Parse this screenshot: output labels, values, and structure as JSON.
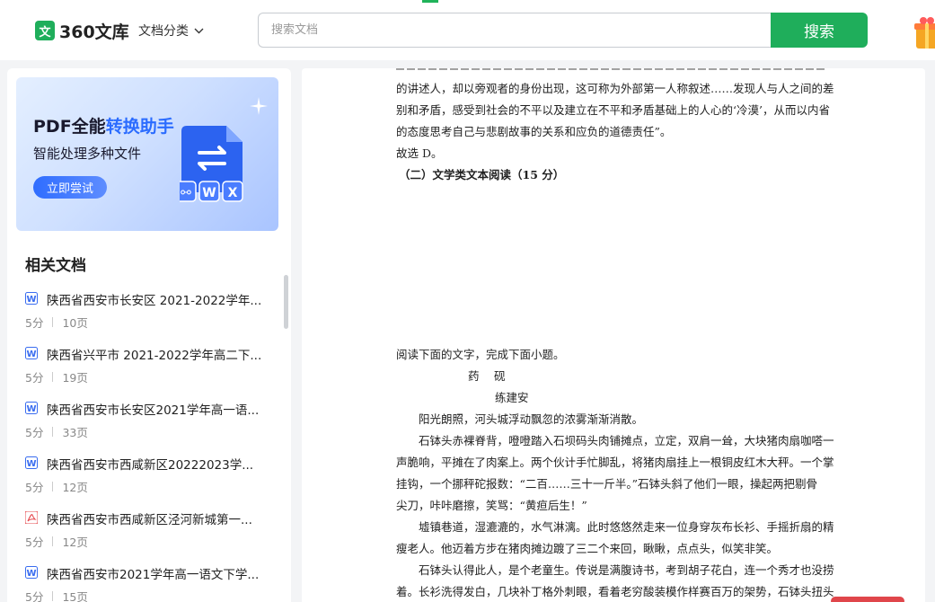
{
  "header": {
    "logo_mark": "文",
    "logo_text": "360文库",
    "category_label": "文档分类",
    "search_placeholder": "搜索文档",
    "search_button": "搜索"
  },
  "banner": {
    "title_prefix": "PDF全能",
    "title_highlight": "转换助手",
    "subtitle": "智能处理多种文件",
    "cta": "立即尝试"
  },
  "related": {
    "title": "相关文档",
    "items": [
      {
        "type": "word",
        "name": "陕西省西安市长安区 2021-2022学年...",
        "score": "5分",
        "pages": "10页"
      },
      {
        "type": "word",
        "name": "陕西省兴平市 2021-2022学年高二下...",
        "score": "5分",
        "pages": "19页"
      },
      {
        "type": "word",
        "name": "陕西省西安市长安区2021学年高一语...",
        "score": "5分",
        "pages": "33页"
      },
      {
        "type": "word",
        "name": "陕西省西安市西咸新区20222023学...",
        "score": "5分",
        "pages": "12页"
      },
      {
        "type": "pdf",
        "name": "陕西省西安市西咸新区泾河新城第一...",
        "score": "5分",
        "pages": "12页"
      },
      {
        "type": "word",
        "name": "陕西省西安市2021学年高一语文下学...",
        "score": "5分",
        "pages": "15页"
      }
    ]
  },
  "document": {
    "lines": [
      "的讲述人，却以旁观者的身份出现，这可称为外部第一人称叙述……发现人与人之间的差",
      "别和矛盾，感受到社会的不平以及建立在不平和矛盾基础上的人心的‘冷漠’，从而以内省",
      "的态度思考自己与悲剧故事的关系和应负的道德责任”。",
      "故选 D。",
      "（二）文学类文本阅读（15 分）",
      "阅读下面的文字，完成下面小题。",
      "药　 砚",
      "练建安",
      "阳光朗照，河头城浮动飘忽的浓雾渐渐消散。",
      "石钵头赤裸脊背，噔噔踏入石坝码头肉铺摊点，立定，双肩一耸，大块猪肉扇咖嗒一",
      "声脆响，平摊在了肉案上。两个伙计手忙脚乱，将猪肉扇挂上一根铜皮红木大秤。一个掌",
      "挂钩，一个挪秤砣报数：“二百……三十一斤半。”石钵头斜了他们一眼，操起两把剔骨",
      "尖刀，咔咔磨擦，笑骂：“黄疸后生！”",
      "墟镇巷道，湿漉漉的，水气淋漓。此时悠悠然走来一位身穿灰布长衫、手摇折扇的精",
      "瘦老人。他迈着方步在猪肉摊边踱了三二个来回，瞅瞅，点点头，似笑非笑。",
      "石钵头认得此人，是个老童生。传说是满腹诗书，考到胡子花白，连一个秀才也没捞",
      "着。长衫洗得发白，几块补丁格外刺眼，看着老穷酸装模作样赛百万的架势，石钵头扭头"
    ]
  }
}
